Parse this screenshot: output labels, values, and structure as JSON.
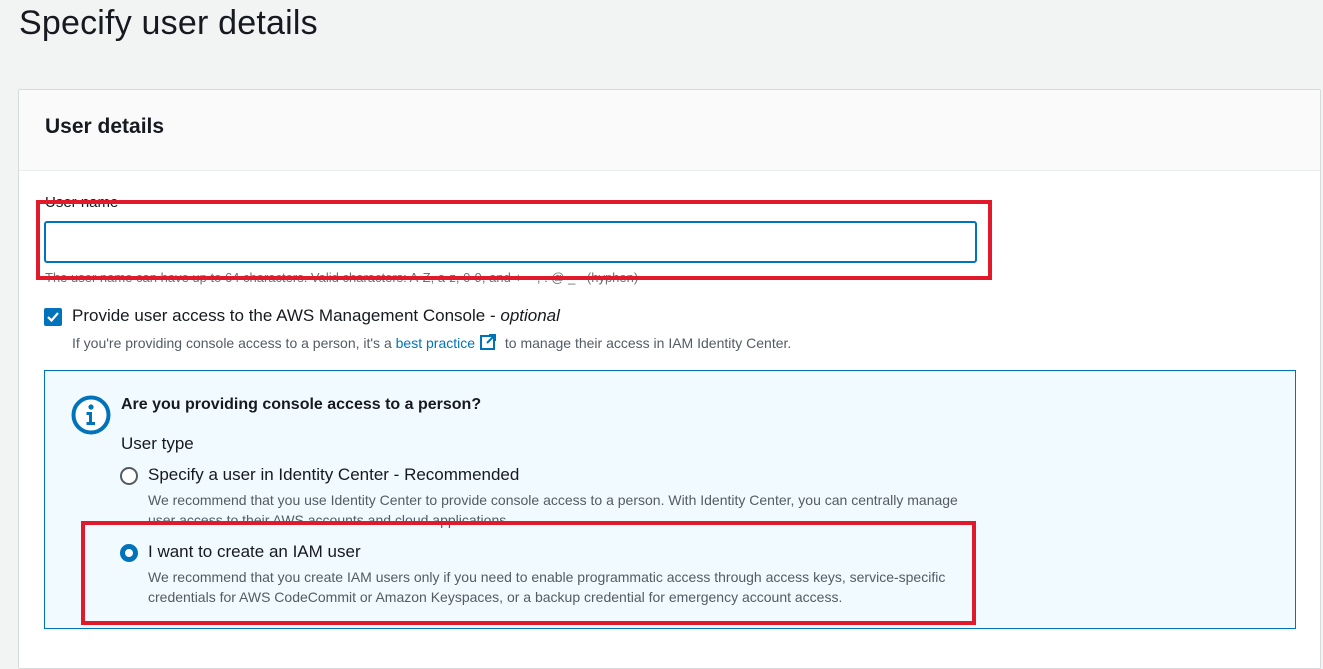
{
  "page": {
    "title": "Specify user details"
  },
  "panel": {
    "title": "User details",
    "username": {
      "label": "User name",
      "value": "",
      "placeholder": "",
      "hint": "The user name can have up to 64 characters. Valid characters: A-Z, a-z, 0-9, and + = , . @ _ - (hyphen)"
    },
    "console_access": {
      "checked": true,
      "label": "Provide user access to the AWS Management Console - ",
      "optional": "optional",
      "desc_before": "If you're providing console access to a person, it's a ",
      "desc_link": "best practice",
      "desc_after": " to manage their access in IAM Identity Center."
    },
    "info_box": {
      "icon": "info-circle-icon",
      "title": "Are you providing console access to a person?",
      "user_type_label": "User type",
      "options": [
        {
          "label": "Specify a user in Identity Center - Recommended",
          "desc": "We recommend that you use Identity Center to provide console access to a person. With Identity Center, you can centrally manage user access to their AWS accounts and cloud applications.",
          "selected": false
        },
        {
          "label": "I want to create an IAM user",
          "desc": "We recommend that you create IAM users only if you need to enable programmatic access through access keys, service-specific credentials for AWS CodeCommit or Amazon Keyspaces, or a backup credential for emergency account access.",
          "selected": true
        }
      ]
    }
  },
  "colors": {
    "accent": "#0073bb",
    "highlight": "#e01a2b",
    "info_bg": "#f1faff",
    "page_bg": "#f2f3f3"
  }
}
